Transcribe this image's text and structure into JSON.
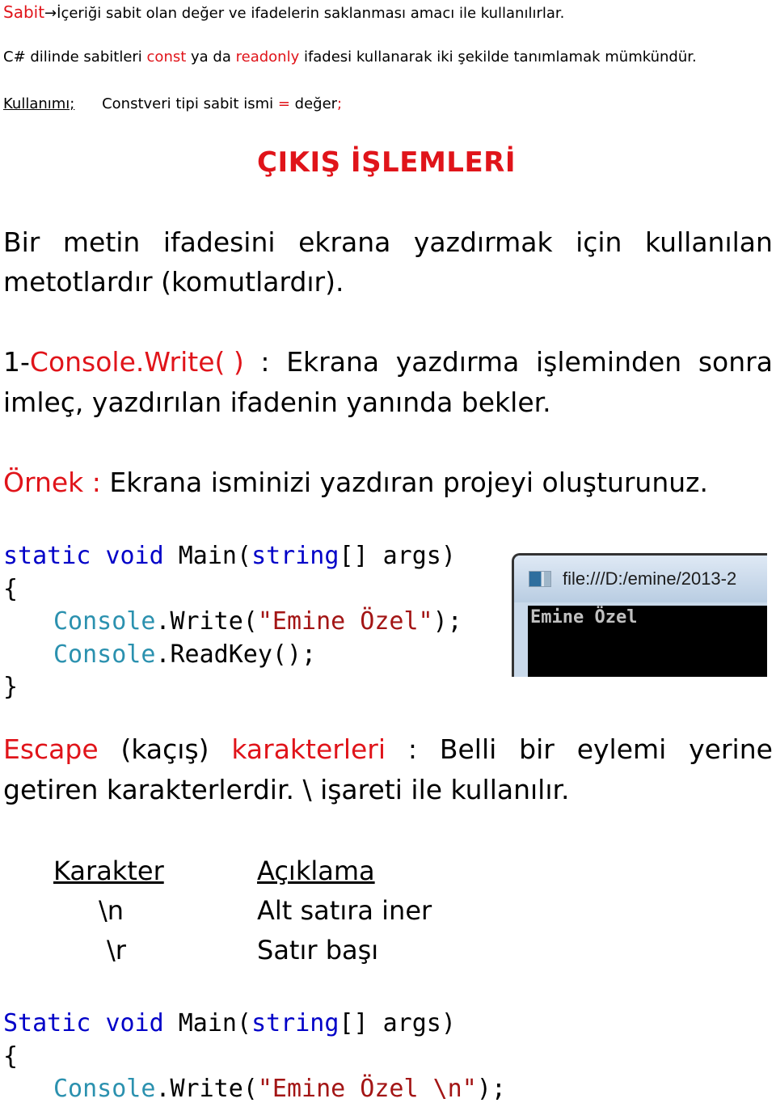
{
  "intro": {
    "sabit_term": "Sabit",
    "arrow": "→",
    "sabit_definition": "İçeriği sabit olan değer ve ifadelerin saklanması amacı ile kullanılırlar.",
    "line2_prefix": "C# dilinde sabitleri ",
    "const_kw": "const",
    "line2_mid": " ya da ",
    "readonly_kw": "readonly",
    "line2_suffix": " ifadesi kullanarak iki şekilde tanımlamak mümkündür.",
    "usage_label": "Kullanımı;",
    "usage_syntax": "Constveri tipi   sabit ismi ",
    "usage_equals": "=",
    "usage_value": " değer",
    "usage_semicolon": ";"
  },
  "section_title": "ÇIKIŞ İŞLEMLERİ",
  "output_def": {
    "line1_words": [
      "Bir",
      "metin",
      "ifadesini",
      "ekrana",
      "yazdırmak",
      "için",
      "kullanılan"
    ],
    "line2": "metotlardır (komutlardır)."
  },
  "write_method": {
    "prefix": "1-",
    "method": "Console.Write( )",
    "line1_words": [
      ":",
      "Ekrana",
      "yazdırma",
      "işleminden",
      "sonra"
    ],
    "line2": "imleç, yazdırılan ifadenin yanında bekler."
  },
  "example": {
    "label": "Örnek :",
    "text": " Ekrana isminizi yazdıran projeyi oluşturunuz."
  },
  "code1": {
    "kw_static": "static",
    "kw_void": "void",
    "main": " Main(",
    "kw_string": "string",
    "args": "[] args)",
    "open_brace": "{",
    "console": "Console",
    "write": ".Write(",
    "string_literal": "\"Emine Özel\"",
    "write_end": ");",
    "readkey": ".ReadKey();",
    "close_brace": "}"
  },
  "console_window": {
    "path": "file:///D:/emine/2013-2",
    "output": "Emine Özel"
  },
  "escape": {
    "term": "Escape",
    "kacis": "(kaçış)",
    "karakterleri": "karakterleri",
    "line1_rest": [
      ":",
      "Belli",
      "bir",
      "eylemi",
      "yerine"
    ],
    "line2": "getiren karakterlerdir. \\ işareti ile kullanılır."
  },
  "escape_table": {
    "headers": [
      "Karakter",
      "Açıklama"
    ],
    "rows": [
      [
        "\\n",
        "Alt satıra iner"
      ],
      [
        "\\r",
        "Satır başı"
      ]
    ]
  },
  "code2": {
    "kw_static": "Static",
    "kw_void": "void",
    "main": " Main(",
    "kw_string": "string",
    "args": "[] args)",
    "open_brace": "{",
    "console": "Console",
    "write": ".Write(",
    "string_literal": "\"Emine Özel \\n\"",
    "write_end": ");"
  }
}
